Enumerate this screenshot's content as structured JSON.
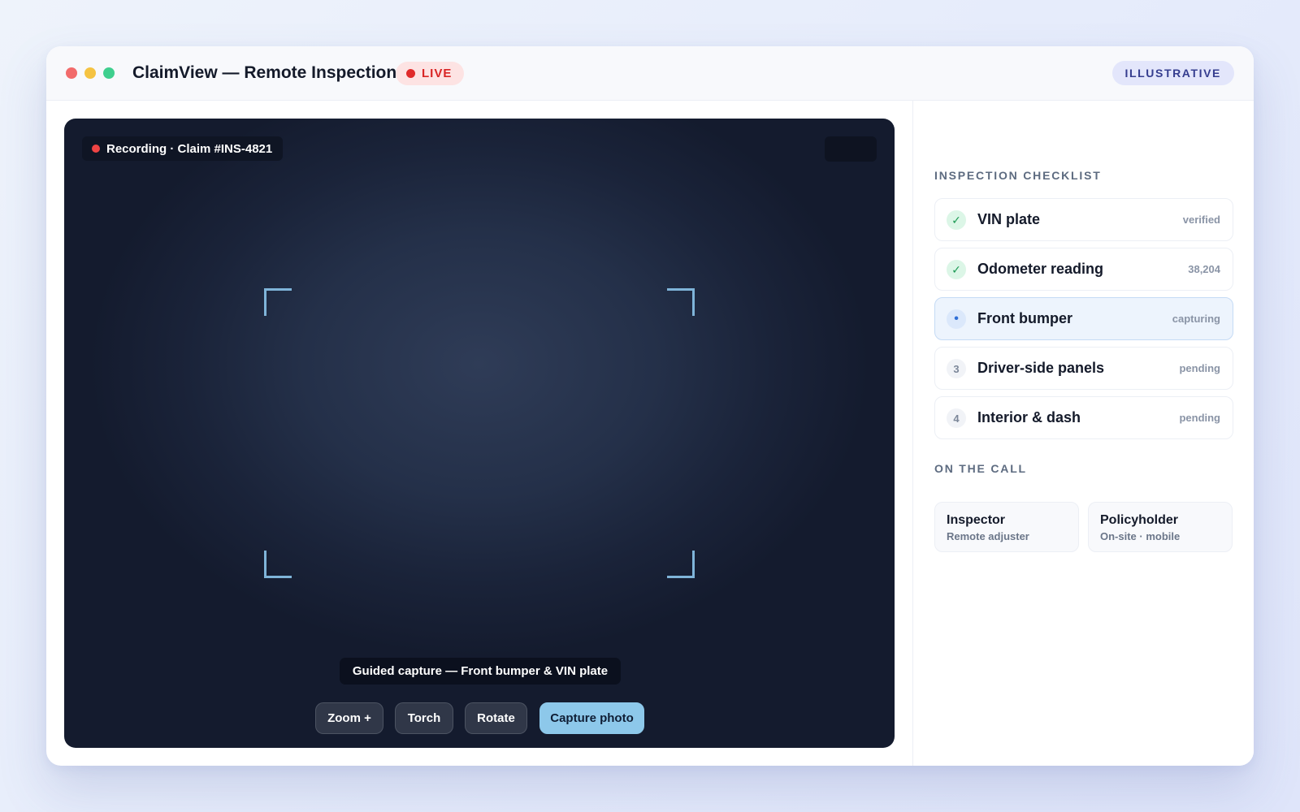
{
  "window": {
    "title": "ClaimView — Remote Inspection",
    "live_label": "LIVE",
    "illustrative_label": "ILLUSTRATIVE"
  },
  "camera": {
    "recording_label": "Recording · Claim #INS-4821",
    "guide_text": "Guided capture — Front bumper & VIN plate",
    "buttons": {
      "zoom": "Zoom +",
      "torch": "Torch",
      "rotate": "Rotate",
      "capture": "Capture photo"
    }
  },
  "checklist": {
    "title": "INSPECTION CHECKLIST",
    "items": [
      {
        "icon": "✓",
        "label": "VIN plate",
        "status": "verified",
        "state": "done"
      },
      {
        "icon": "✓",
        "label": "Odometer reading",
        "status": "38,204",
        "state": "done"
      },
      {
        "icon": "•",
        "label": "Front bumper",
        "status": "capturing",
        "state": "current"
      },
      {
        "icon": "3",
        "label": "Driver-side panels",
        "status": "pending",
        "state": "pending"
      },
      {
        "icon": "4",
        "label": "Interior & dash",
        "status": "pending",
        "state": "pending"
      }
    ]
  },
  "call": {
    "title": "ON THE CALL",
    "participants": [
      {
        "name": "Inspector",
        "role": "Remote adjuster"
      },
      {
        "name": "Policyholder",
        "role": "On-site · mobile"
      }
    ]
  },
  "colors": {
    "live_red": "#d92525",
    "accent_blue": "#8dc8ea",
    "done_green": "#1c9a54",
    "current_blue": "#2f6fd6"
  }
}
